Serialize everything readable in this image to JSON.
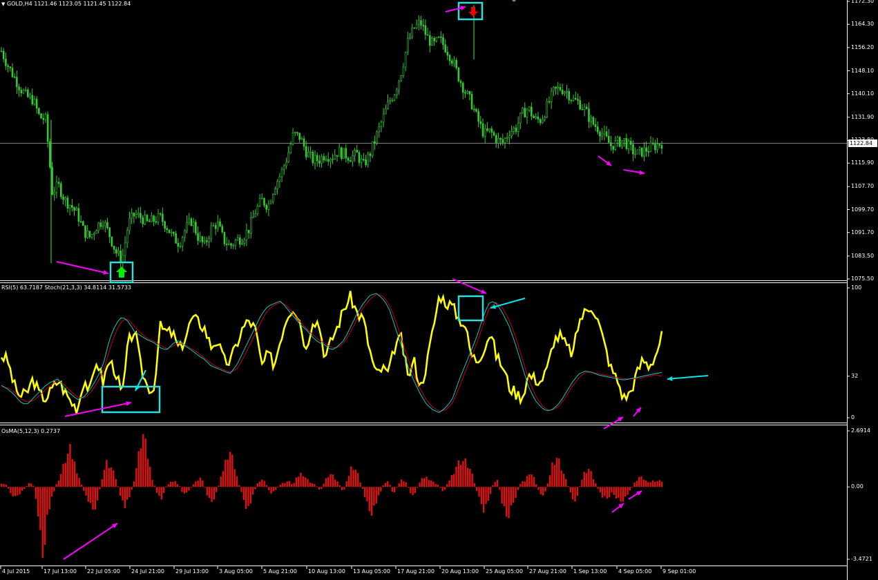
{
  "header": {
    "main": "GOLD,H4  1121.46 1123.05 1121.45 1122.84",
    "osc": "RSI(5) 63.7187  Stoch(21,3,3) 34.8114 31.5733",
    "osma": "OsMA(5,12,3) 0.2737"
  },
  "current_price_label": "1122.84",
  "colors": {
    "background": "#000000",
    "candles": "#33cc33",
    "rsi": "#ffff00",
    "stoch_main": "#00cccc",
    "stoch_signal": "#cc0000",
    "osma": "#dd1111",
    "box": "#33dddd",
    "arrow_magenta": "#ff00ff",
    "arrow_cyan": "#00e5ee",
    "buy_arrow": "#00ee00",
    "sell_arrow": "#ee0000"
  },
  "chart_data": [
    {
      "type": "candlestick",
      "series": [
        {
          "name": "GOLD,H4"
        }
      ],
      "price_axis_ticks": [
        "1172.30",
        "1164.30",
        "1156.20",
        "1148.10",
        "1140.10",
        "1131.90",
        "1123.80",
        "1115.90",
        "1107.70",
        "1099.70",
        "1091.70",
        "1083.50",
        "1075.50"
      ],
      "ylim": [
        1075.5,
        1172.3
      ],
      "current_price": 1122.84,
      "close_path": [
        1155,
        1150,
        1146,
        1142,
        1139,
        1138,
        1132,
        1131,
        1106,
        1108,
        1103,
        1101,
        1098,
        1092,
        1090,
        1094,
        1096,
        1091,
        1085,
        1082,
        1095,
        1098,
        1097,
        1095,
        1096,
        1097,
        1094,
        1090,
        1088,
        1093,
        1096,
        1090,
        1087,
        1093,
        1095,
        1089,
        1087,
        1089,
        1090,
        1093,
        1099,
        1103,
        1101,
        1108,
        1112,
        1118,
        1126,
        1125,
        1120,
        1117,
        1117,
        1119,
        1118,
        1120,
        1119,
        1118,
        1119,
        1115,
        1119,
        1125,
        1131,
        1137,
        1141,
        1148,
        1158,
        1163,
        1165,
        1160,
        1157,
        1159,
        1156,
        1152,
        1146,
        1141,
        1137,
        1131,
        1126,
        1127,
        1124,
        1123,
        1127,
        1128,
        1133,
        1135,
        1131,
        1131,
        1136,
        1141,
        1142,
        1141,
        1138,
        1137,
        1134,
        1130,
        1128,
        1125,
        1122,
        1123,
        1124,
        1121,
        1119,
        1120,
        1121,
        1122,
        1123
      ]
    },
    {
      "type": "line",
      "series": [
        {
          "name": "RSI(5)"
        },
        {
          "name": "Stoch(21,3,3)"
        }
      ],
      "y_axis_ticks": [
        "100",
        "32",
        "0"
      ],
      "ylim": [
        0,
        100
      ],
      "rsi": [
        48,
        44,
        25,
        16,
        19,
        30,
        18,
        15,
        22,
        29,
        20,
        12,
        7,
        30,
        20,
        45,
        28,
        44,
        36,
        16,
        58,
        68,
        38,
        24,
        22,
        70,
        66,
        65,
        52,
        62,
        77,
        74,
        69,
        55,
        60,
        44,
        43,
        56,
        69,
        75,
        68,
        40,
        49,
        41,
        62,
        79,
        86,
        75,
        52,
        76,
        73,
        46,
        60,
        71,
        85,
        93,
        81,
        76,
        52,
        33,
        38,
        34,
        56,
        61,
        31,
        44,
        23,
        42,
        69,
        95,
        89,
        86,
        77,
        72,
        48,
        44,
        54,
        66,
        47,
        39,
        24,
        19,
        16,
        33,
        30,
        28,
        38,
        60,
        63,
        55,
        49,
        75,
        82,
        87,
        74,
        56,
        38,
        29,
        15,
        19,
        33,
        45,
        40,
        48,
        63
      ],
      "stoch_main": [
        25,
        22,
        18,
        12,
        10,
        15,
        20,
        25,
        28,
        30,
        22,
        18,
        14,
        16,
        22,
        30,
        40,
        60,
        72,
        78,
        74,
        66,
        63,
        60,
        58,
        54,
        52,
        57,
        60,
        55,
        52,
        48,
        45,
        40,
        38,
        36,
        34,
        40,
        50,
        60,
        70,
        80,
        86,
        88,
        90,
        84,
        78,
        72,
        68,
        62,
        58,
        56,
        52,
        55,
        60,
        70,
        80,
        88,
        94,
        96,
        92,
        85,
        70,
        55,
        40,
        28,
        18,
        10,
        6,
        4,
        8,
        14,
        28,
        40,
        52,
        64,
        80,
        90,
        88,
        80,
        70,
        56,
        40,
        24,
        14,
        8,
        5,
        7,
        12,
        20,
        28,
        34,
        36,
        35,
        33,
        32,
        31,
        30,
        29,
        30,
        31,
        32,
        33,
        34,
        35
      ],
      "stoch_signal": [
        24,
        23,
        20,
        15,
        12,
        13,
        17,
        22,
        26,
        29,
        25,
        20,
        16,
        15,
        19,
        26,
        35,
        52,
        66,
        75,
        76,
        70,
        65,
        61,
        59,
        56,
        53,
        55,
        58,
        56,
        53,
        50,
        46,
        42,
        39,
        37,
        35,
        37,
        45,
        55,
        65,
        75,
        83,
        87,
        89,
        86,
        80,
        74,
        69,
        64,
        60,
        57,
        54,
        54,
        58,
        66,
        76,
        85,
        91,
        95,
        94,
        88,
        76,
        61,
        46,
        32,
        22,
        13,
        8,
        5,
        6,
        11,
        22,
        35,
        47,
        59,
        74,
        86,
        89,
        84,
        75,
        62,
        46,
        30,
        18,
        10,
        6,
        6,
        10,
        17,
        25,
        31,
        35,
        35,
        34,
        33,
        32,
        31,
        30,
        30,
        30,
        31,
        32,
        33,
        32
      ]
    },
    {
      "type": "bar",
      "series": [
        {
          "name": "OsMA(5,12,3)"
        }
      ],
      "y_axis_ticks": [
        "2.6914",
        "0.00",
        "-3.4721"
      ],
      "ylim": [
        -3.4721,
        2.6914
      ],
      "values": [
        0.2,
        0.1,
        -0.3,
        -0.5,
        -0.3,
        -0.1,
        0.2,
        0.1,
        -1.2,
        -3.4,
        -1.5,
        -0.6,
        0.1,
        0.6,
        1.3,
        1.8,
        1.2,
        0.5,
        -0.2,
        -0.6,
        -1.1,
        -0.8,
        0.4,
        1.2,
        1.0,
        0.5,
        -0.3,
        -1.0,
        -0.6,
        0.2,
        1.4,
        2.6,
        1.6,
        0.5,
        -0.2,
        -0.7,
        0.0,
        0.2,
        0.3,
        0.1,
        -0.4,
        -0.2,
        0.1,
        0.3,
        0.5,
        -0.3,
        -0.8,
        -0.4,
        0.3,
        1.1,
        1.9,
        1.2,
        0.2,
        -0.5,
        -1.1,
        -0.6,
        0.1,
        0.4,
        0.2,
        -0.3,
        -0.2,
        0.1,
        0.2,
        0.3,
        0.1,
        0.5,
        0.7,
        0.4,
        0.2,
        0.1,
        -0.2,
        0.3,
        0.7,
        0.5,
        0.2,
        -0.3,
        0.4,
        1.1,
        0.8,
        0.1,
        -0.6,
        -1.3,
        -0.9,
        -0.4,
        0.2,
        0.3,
        -0.4,
        0.1,
        0.4,
        0.2,
        -0.5,
        -0.2,
        0.3,
        0.5,
        0.4,
        0.2,
        0.1,
        -0.3,
        0.2,
        0.6,
        1.1,
        1.3,
        1.2,
        0.8,
        0.1,
        -0.7,
        -1.2,
        -0.6,
        0.2,
        0.3,
        -0.9,
        -1.6,
        -1.0,
        -0.4,
        0.2,
        0.3,
        0.8,
        0.4,
        -0.2,
        -0.5,
        0.2,
        1.2,
        1.5,
        0.9,
        0.3,
        -0.3,
        -0.8,
        0.1,
        0.7,
        0.9,
        0.4,
        -0.1,
        -0.5,
        -0.6,
        -0.3,
        -0.5,
        -0.7,
        -0.5,
        -0.2,
        0.2,
        0.5,
        0.4,
        0.2,
        0.3,
        0.3,
        0.3
      ]
    }
  ],
  "time_axis_labels": [
    "4 Jul 2015",
    "17 Jul 13:00",
    "22 Jul 05:00",
    "24 Jul 21:00",
    "29 Jul 13:00",
    "3 Aug 05:00",
    "5 Aug 21:00",
    "10 Aug 13:00",
    "13 Aug 05:00",
    "17 Aug 21:00",
    "20 Aug 13:00",
    "25 Aug 05:00",
    "27 Aug 21:00",
    "1 Sep 13:00",
    "4 Sep 05:00",
    "9 Sep 01:00"
  ]
}
